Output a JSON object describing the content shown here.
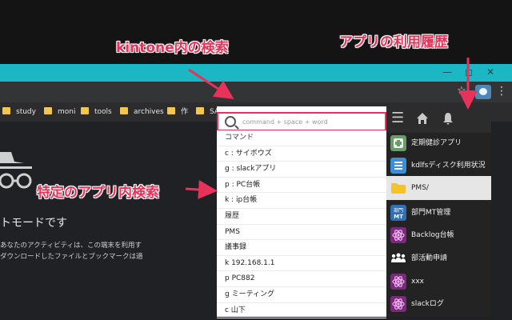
{
  "annotations": {
    "search": "kintone内の検索",
    "history": "アプリの利用履歴",
    "app_search": "特定のアプリ内検索"
  },
  "bookmarks": [
    "study",
    "moni",
    "tools",
    "archives",
    "作",
    "SA"
  ],
  "incognito": {
    "title": "トモードです",
    "desc1": "あなたのアクティビティは、この端末を利用す",
    "desc2": "ダウンロードしたファイルとブックマークは適"
  },
  "search": {
    "placeholder": "command + space + word"
  },
  "popup": {
    "commands_heading": "コマンド",
    "commands": [
      "c : サイボウズ",
      "g : slackアプリ",
      "p : PC台帳",
      "k : ip台帳"
    ],
    "history_heading": "履歴",
    "history": [
      "PMS",
      "議事録",
      "k 192.168.1.1",
      "p PC882",
      "g ミーティング",
      "c 山下"
    ]
  },
  "apps": [
    {
      "label": "定期健診アプリ",
      "icon": "health-app-icon",
      "color": "#6b9b6b"
    },
    {
      "label": "kdlfsディスク利用状況",
      "icon": "list-app-icon",
      "color": "#3c8fd6"
    },
    {
      "label": "PMS/",
      "icon": "folder-app-icon",
      "color": "#f5c228"
    },
    {
      "label": "部門MT管理",
      "icon": "meeting-app-icon",
      "color": "#2f6fb5",
      "icon_text": "部門MT"
    },
    {
      "label": "Backlog台帳",
      "icon": "atom-app-icon",
      "color": "#7a2a7a"
    },
    {
      "label": "部活動申請",
      "icon": "group-app-icon",
      "color": "#232323"
    },
    {
      "label": "xxx",
      "icon": "atom-app-icon",
      "color": "#7a2a7a"
    },
    {
      "label": "slackログ",
      "icon": "atom-app-icon",
      "color": "#7a2a7a"
    }
  ],
  "colors": {
    "accent": "#e8325a",
    "chrome": "#1cb7c4"
  }
}
